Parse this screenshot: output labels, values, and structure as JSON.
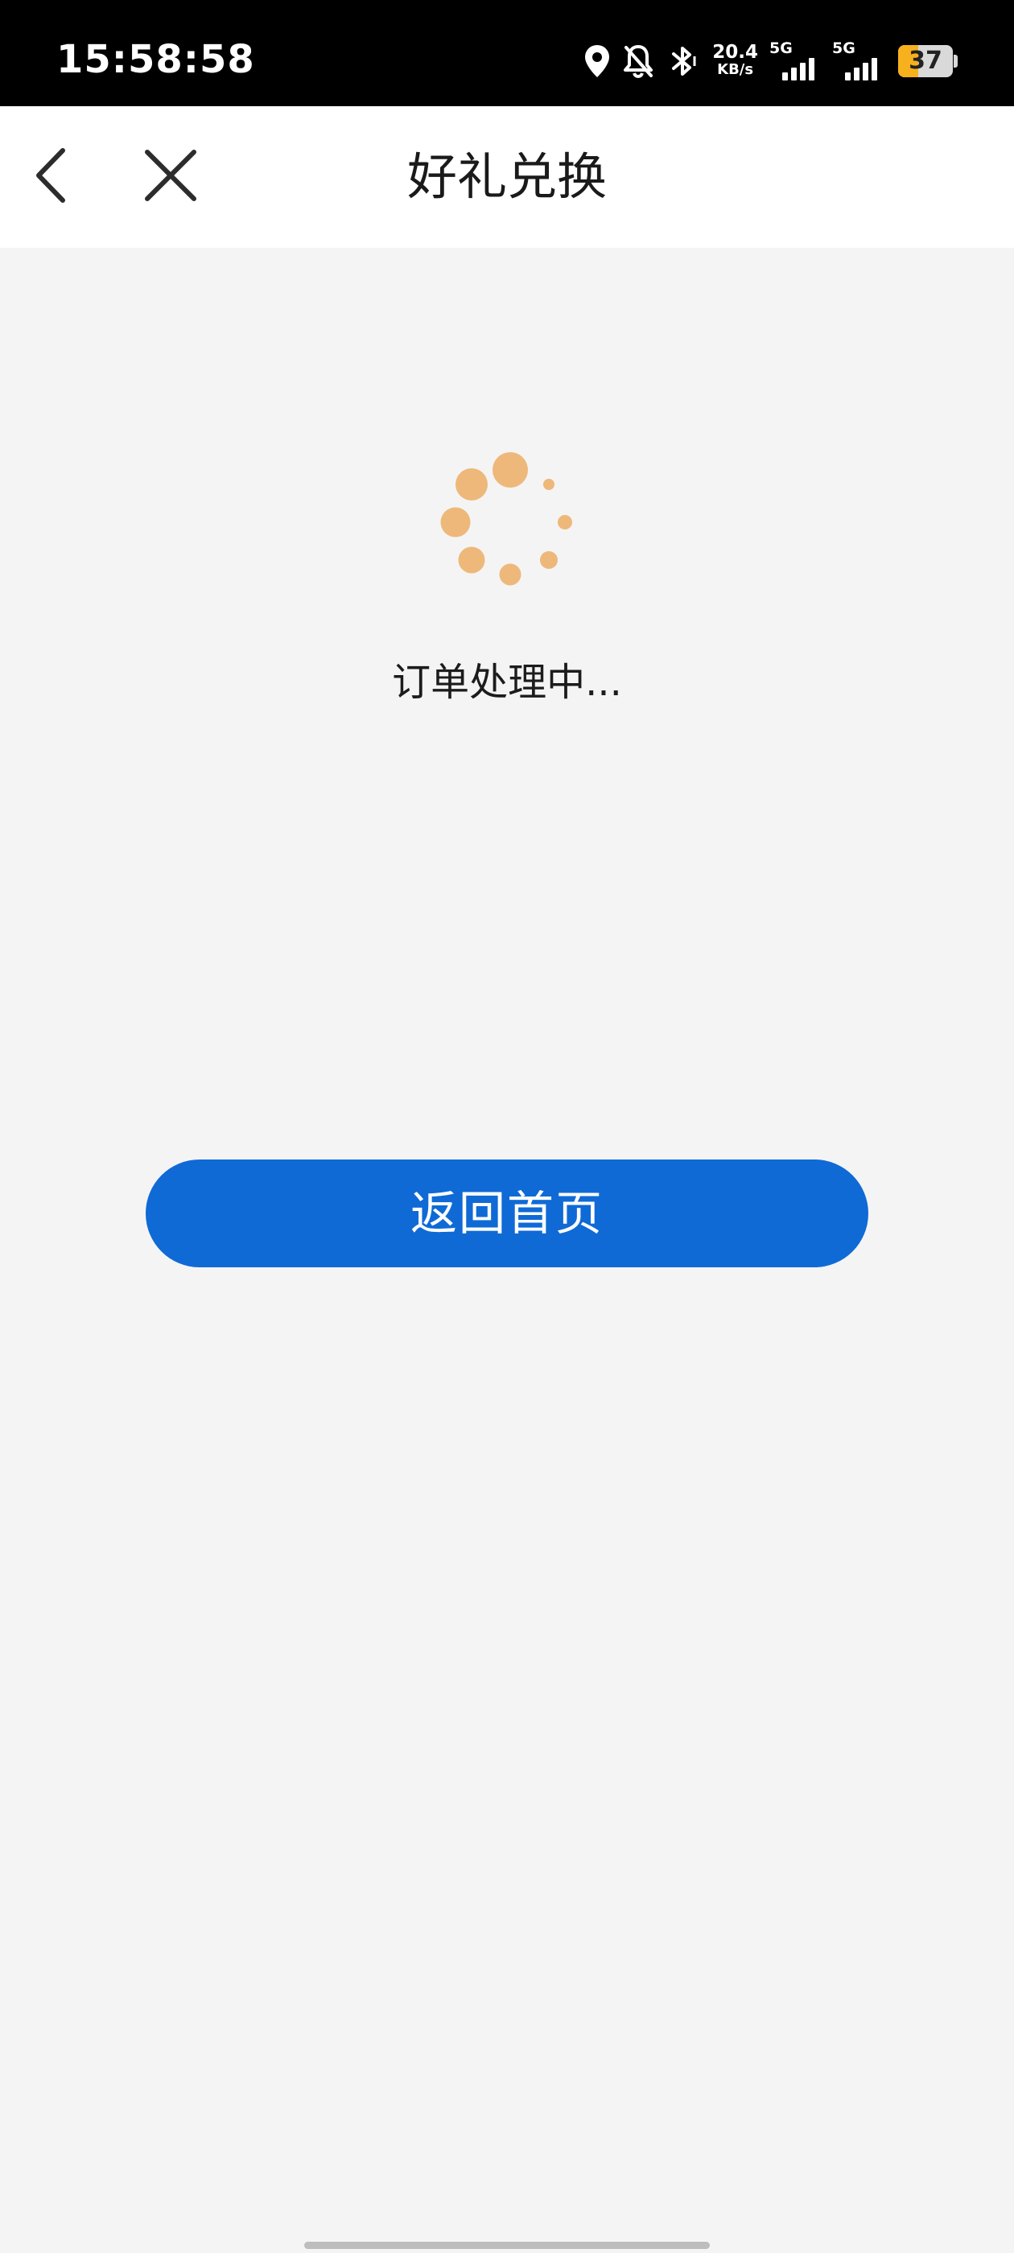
{
  "status_bar": {
    "time": "15:58:58",
    "net_speed_value": "20.4",
    "net_speed_unit": "KB/s",
    "sim1_label": "5G",
    "sim2_label": "5G",
    "battery_level": "37",
    "battery_percent": 37,
    "icons": [
      "location-icon",
      "bell-off-icon",
      "bluetooth-icon",
      "signal-icon",
      "battery-icon"
    ]
  },
  "nav": {
    "title": "好礼兑换",
    "back_icon": "chevron-left-icon",
    "close_icon": "close-icon"
  },
  "main": {
    "status_message": "订单处理中...",
    "home_button_label": "返回首页"
  },
  "colors": {
    "accent": "#0f6ad6",
    "spinner": "#eeb87a",
    "background": "#f4f4f5",
    "battery_fill": "#f6b11c"
  }
}
